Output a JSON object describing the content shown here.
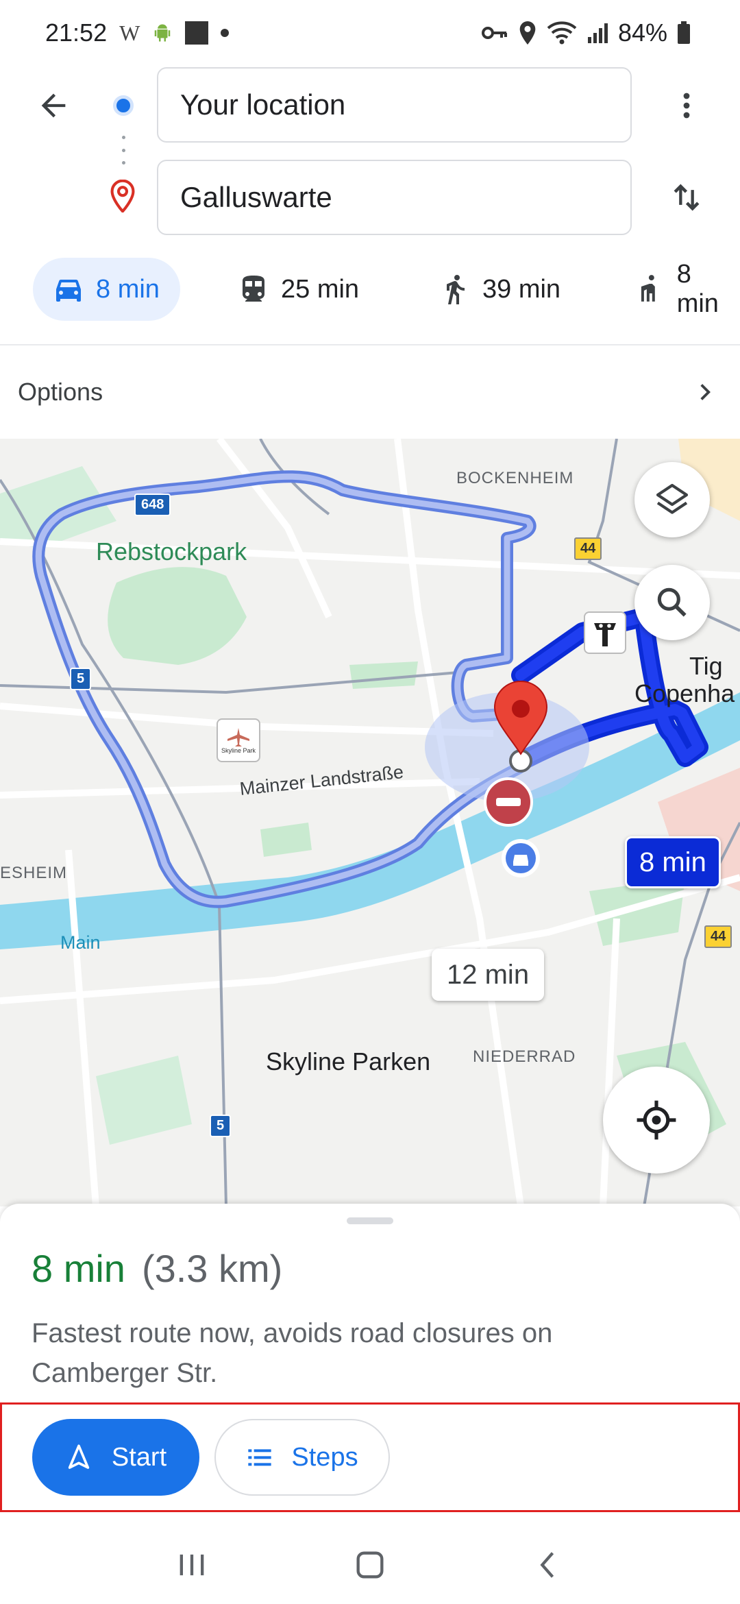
{
  "status_bar": {
    "time": "21:52",
    "app_letter": "W",
    "battery": "84%"
  },
  "header": {
    "origin_value": "Your location",
    "destination_value": "Galluswarte"
  },
  "modes": [
    {
      "label": "8 min",
      "icon": "car-icon",
      "selected": true
    },
    {
      "label": "25 min",
      "icon": "transit-icon",
      "selected": false
    },
    {
      "label": "39 min",
      "icon": "walk-icon",
      "selected": false
    },
    {
      "label": "8 min",
      "icon": "rideshare-icon",
      "selected": false
    }
  ],
  "options": {
    "label": "Options"
  },
  "map": {
    "labels": {
      "bockenheim": "BOCKENHEIM",
      "rebstockpark": "Rebstockpark",
      "mainzer": "Mainzer Landstraße",
      "esheim": "ESHEIM",
      "main": "Main",
      "skyline": "Skyline Parken",
      "niederrad": "NIEDERRAD",
      "tiger_line1": "Tig",
      "tiger_line2": "Copenha",
      "skyline_icon_text": "Skyline Park"
    },
    "shields": {
      "r648": "648",
      "r5a": "5",
      "r5b": "5",
      "r44a": "44",
      "r44b": "44"
    },
    "selected_route_time": "8 min",
    "alt_route_time": "12 min",
    "colors": {
      "selected_route": "#0b2bd6",
      "alt_route": "#8fa6ec",
      "river": "#8fd7ee",
      "park": "#c9ead0"
    }
  },
  "sheet": {
    "duration": "8 min",
    "distance": "(3.3 km)",
    "description": "Fastest route now, avoids road closures on Camberger Str.",
    "start_label": "Start",
    "steps_label": "Steps"
  }
}
